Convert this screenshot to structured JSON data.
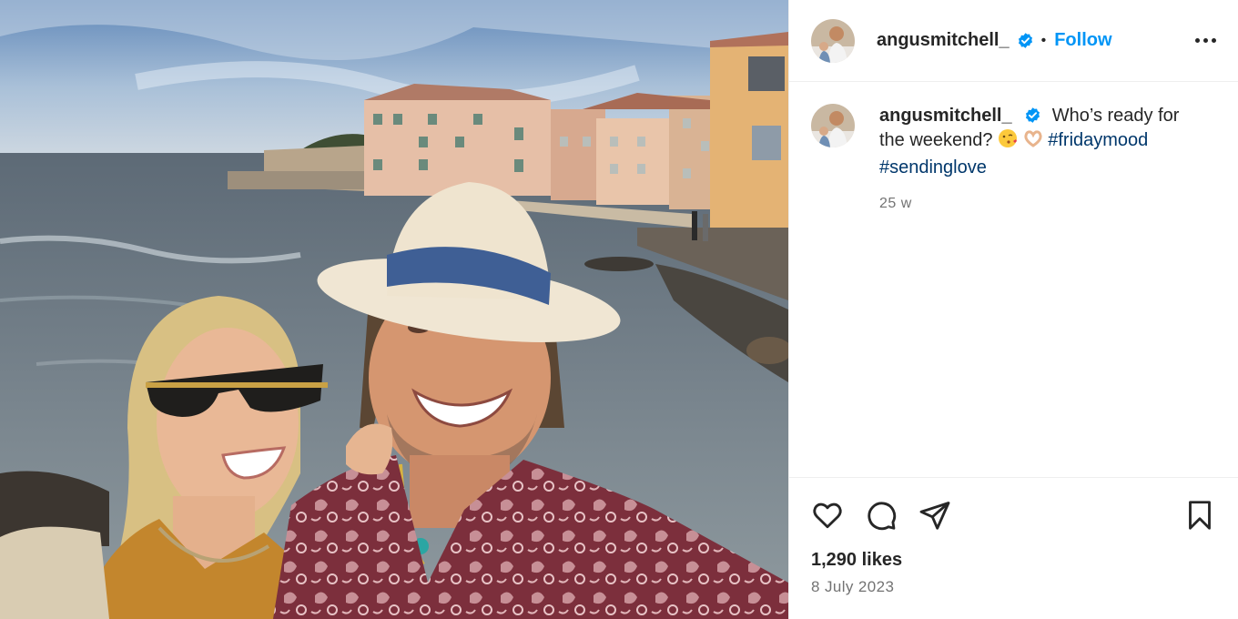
{
  "post": {
    "username": "angusmitchell_",
    "follow_label": "Follow",
    "separator": "•",
    "caption": {
      "text": "Who’s ready for the weekend?",
      "emoji": [
        "face-blowing-kiss",
        "heart-hands"
      ],
      "hashtags": [
        "#fridaymood",
        "#sendinglove"
      ]
    },
    "time_ago": "25 w",
    "likes": "1,290 likes",
    "date": "8 July 2023"
  },
  "icons": {
    "verified": "verified-badge-icon",
    "more": "more-options-icon",
    "like": "heart-icon",
    "comment": "comment-icon",
    "share": "paper-plane-icon",
    "save": "bookmark-icon"
  },
  "colors": {
    "follow": "#0095f6",
    "hashtag": "#00376b",
    "verified": "#0095f6",
    "muted_text": "#737373"
  }
}
